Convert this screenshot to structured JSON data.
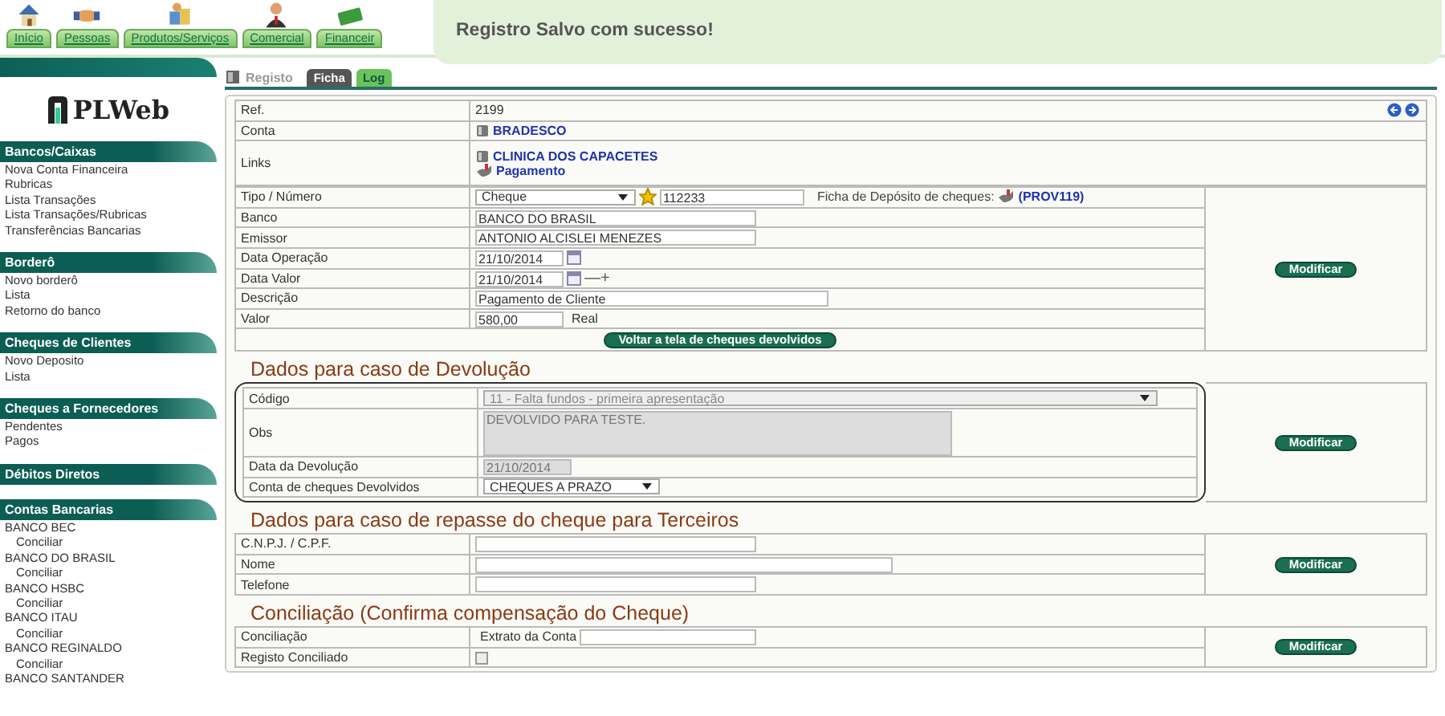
{
  "top_menu": {
    "tabs": [
      {
        "label": "Início"
      },
      {
        "label": "Pessoas"
      },
      {
        "label": "Produtos/Serviços"
      },
      {
        "label": "Comercial"
      },
      {
        "label": "Financeir"
      }
    ]
  },
  "toast": {
    "message": "Registro Salvo com sucesso!"
  },
  "sidebar": {
    "logo": "PLWeb",
    "sections": [
      {
        "title": "Bancos/Caixas",
        "items": [
          {
            "label": "Nova Conta Financeira"
          },
          {
            "label": "Rubricas"
          },
          {
            "label": "Lista Transações"
          },
          {
            "label": "Lista Transações/Rubricas"
          },
          {
            "label": "Transferências Bancarias"
          }
        ]
      },
      {
        "title": "Borderô",
        "items": [
          {
            "label": "Novo borderô"
          },
          {
            "label": "Lista"
          },
          {
            "label": "Retorno do banco"
          }
        ]
      },
      {
        "title": "Cheques de Clientes",
        "items": [
          {
            "label": "Novo Deposito"
          },
          {
            "label": "Lista"
          }
        ]
      },
      {
        "title": "Cheques a Fornecedores",
        "items": [
          {
            "label": "Pendentes"
          },
          {
            "label": "Pagos"
          }
        ]
      },
      {
        "title": "Débitos Diretos"
      },
      {
        "title": "Contas Bancarias",
        "items": [
          {
            "label": "BANCO BEC",
            "children": [
              {
                "label": "Conciliar"
              }
            ]
          },
          {
            "label": "BANCO DO BRASIL",
            "children": [
              {
                "label": "Conciliar"
              }
            ]
          },
          {
            "label": "BANCO HSBC",
            "children": [
              {
                "label": "Conciliar"
              }
            ]
          },
          {
            "label": "BANCO ITAU",
            "children": [
              {
                "label": "Conciliar"
              }
            ]
          },
          {
            "label": "BANCO REGINALDO",
            "children": [
              {
                "label": "Conciliar"
              }
            ]
          },
          {
            "label": "BANCO SANTANDER"
          }
        ]
      }
    ]
  },
  "record": {
    "title": "Registo",
    "tabs": [
      {
        "label": "Ficha",
        "selected": true
      },
      {
        "label": "Log",
        "selected": false
      }
    ]
  },
  "sections": [
    {
      "outlined": false,
      "header_rows": [
        {
          "label": "Ref.",
          "kind": "text",
          "value": "2199"
        },
        {
          "label": "Conta",
          "kind": "links",
          "links": [
            "BRADESCO"
          ]
        },
        {
          "label": "Links",
          "kind": "links",
          "links": [
            "CLINICA DOS CAPACETES",
            "Pagamento"
          ]
        }
      ],
      "rows": [
        {
          "label": "Tipo / Número",
          "kind": "select_number",
          "value": "Cheque",
          "number": "112233",
          "extra_label": "Ficha de Depósito de cheques:",
          "extra_link": "(PROV119)",
          "disabled": false
        },
        {
          "label": "Banco",
          "kind": "input",
          "value": "BANCO DO BRASIL",
          "disabled": false
        },
        {
          "label": "Emissor",
          "kind": "input",
          "value": "ANTONIO ALCISLEI MENEZES",
          "disabled": false
        },
        {
          "label": "Data Operação",
          "kind": "date",
          "value": "21/10/2014",
          "disabled": false
        },
        {
          "label": "Data Valor",
          "kind": "date",
          "value": "21/10/2014",
          "stepper": "—+",
          "disabled": false
        },
        {
          "label": "Descrição",
          "kind": "wide_input",
          "value": "Pagamento de Cliente",
          "disabled": false
        },
        {
          "label": "Valor",
          "kind": "input_unit",
          "value": "580,00",
          "unit": "Real",
          "disabled": false
        }
      ],
      "footer_button": "Voltar a tela de cheques devolvidos",
      "side_button": "Modificar"
    },
    {
      "heading": "Dados para caso de Devolução",
      "outlined": true,
      "rows": [
        {
          "label": "Código",
          "kind": "select",
          "value": "11 - Falta fundos - primeira apresentação",
          "wide": true,
          "disabled": true
        },
        {
          "label": "Obs",
          "kind": "textarea",
          "value": "DEVOLVIDO PARA TESTE.",
          "disabled": true
        },
        {
          "label": "Data da Devolução",
          "kind": "date_plain",
          "value": "21/10/2014",
          "disabled": true
        },
        {
          "label": "Conta de cheques Devolvidos",
          "kind": "select",
          "value": "CHEQUES A PRAZO",
          "wide": false,
          "disabled": false
        }
      ],
      "side_button": "Modificar"
    },
    {
      "heading": "Dados para caso de repasse do cheque para Terceiros",
      "outlined": false,
      "rows": [
        {
          "label": "C.N.P.J. / C.P.F.",
          "kind": "input",
          "disabled": false
        },
        {
          "label": "Nome",
          "kind": "long_input",
          "disabled": false
        },
        {
          "label": "Telefone",
          "kind": "input",
          "disabled": false
        }
      ],
      "side_button": "Modificar"
    },
    {
      "heading": "Conciliação (Confirma compensação do Cheque)",
      "outlined": false,
      "rows": [
        {
          "label": "Conciliação",
          "kind": "labeled_input",
          "prefix": "Extrato da Conta",
          "disabled": false
        },
        {
          "label": "Registo Conciliado",
          "kind": "checkbox",
          "checked": false
        }
      ],
      "side_button": "Modificar"
    }
  ]
}
